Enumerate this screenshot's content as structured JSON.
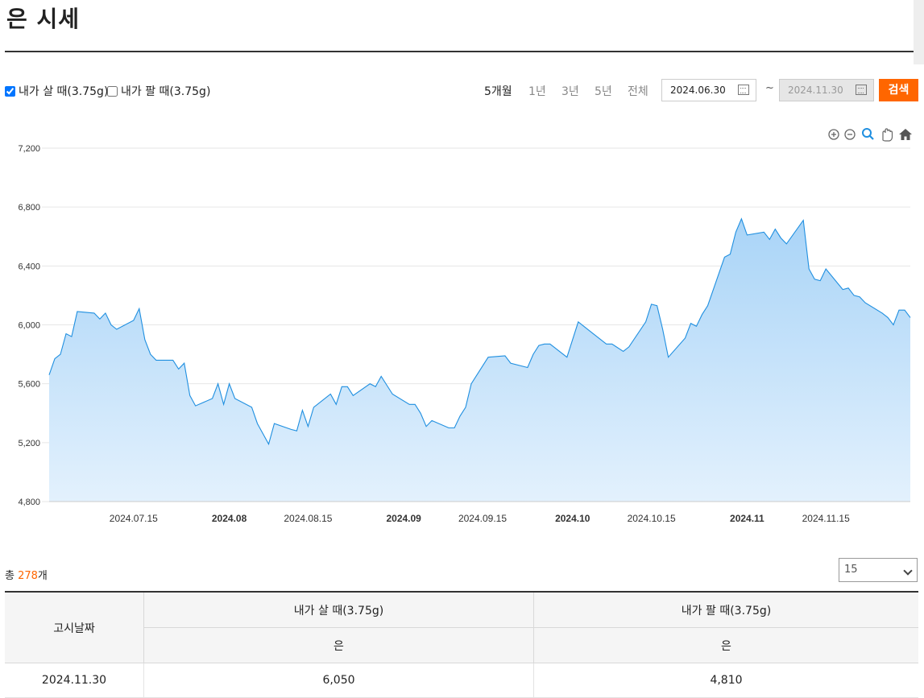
{
  "page": {
    "title": "은 시세"
  },
  "filters": {
    "buy_label": "내가 살 때(3.75g)",
    "buy_checked": true,
    "sell_label": "내가 팔 때(3.75g)",
    "sell_checked": false,
    "periods": [
      "5개월",
      "1년",
      "3년",
      "5년",
      "전체"
    ],
    "active_period": "5개월",
    "start_date": "2024.06.30",
    "end_date": "2024.11.30",
    "tilde": "~",
    "search_label": "검색"
  },
  "chart_data": {
    "type": "area",
    "series": [
      {
        "x": [
          "2024-06-30",
          "2024-07-01",
          "2024-07-02",
          "2024-07-03",
          "2024-07-04",
          "2024-07-05",
          "2024-07-08",
          "2024-07-09",
          "2024-07-10",
          "2024-07-11",
          "2024-07-12",
          "2024-07-15",
          "2024-07-16",
          "2024-07-17",
          "2024-07-18",
          "2024-07-19",
          "2024-07-22",
          "2024-07-23",
          "2024-07-24",
          "2024-07-25",
          "2024-07-26",
          "2024-07-29",
          "2024-07-30",
          "2024-07-31",
          "2024-08-01",
          "2024-08-02",
          "2024-08-05",
          "2024-08-06",
          "2024-08-07",
          "2024-08-08",
          "2024-08-09",
          "2024-08-12",
          "2024-08-13",
          "2024-08-14",
          "2024-08-15",
          "2024-08-16",
          "2024-08-19",
          "2024-08-20",
          "2024-08-21",
          "2024-08-22",
          "2024-08-23",
          "2024-08-26",
          "2024-08-27",
          "2024-08-28",
          "2024-08-29",
          "2024-08-30",
          "2024-09-02",
          "2024-09-03",
          "2024-09-04",
          "2024-09-05",
          "2024-09-06",
          "2024-09-09",
          "2024-09-10",
          "2024-09-11",
          "2024-09-12",
          "2024-09-13",
          "2024-09-16",
          "2024-09-19",
          "2024-09-20",
          "2024-09-23",
          "2024-09-24",
          "2024-09-25",
          "2024-09-26",
          "2024-09-27",
          "2024-09-30",
          "2024-10-02",
          "2024-10-04",
          "2024-10-07",
          "2024-10-08",
          "2024-10-10",
          "2024-10-11",
          "2024-10-14",
          "2024-10-15",
          "2024-10-16",
          "2024-10-17",
          "2024-10-18",
          "2024-10-21",
          "2024-10-22",
          "2024-10-23",
          "2024-10-24",
          "2024-10-25",
          "2024-10-28",
          "2024-10-29",
          "2024-10-30",
          "2024-10-31",
          "2024-11-01",
          "2024-11-04",
          "2024-11-05",
          "2024-11-06",
          "2024-11-07",
          "2024-11-08",
          "2024-11-11",
          "2024-11-12",
          "2024-11-13",
          "2024-11-14",
          "2024-11-15",
          "2024-11-18",
          "2024-11-19",
          "2024-11-20",
          "2024-11-21",
          "2024-11-22",
          "2024-11-25",
          "2024-11-26",
          "2024-11-27",
          "2024-11-28",
          "2024-11-29",
          "2024-11-30"
        ],
        "y": [
          5660,
          5770,
          5800,
          5940,
          5920,
          6090,
          6080,
          6040,
          6080,
          6000,
          5970,
          6030,
          6110,
          5900,
          5800,
          5760,
          5760,
          5700,
          5740,
          5520,
          5450,
          5500,
          5600,
          5460,
          5600,
          5500,
          5440,
          5330,
          5260,
          5190,
          5330,
          5290,
          5280,
          5420,
          5310,
          5440,
          5530,
          5460,
          5580,
          5580,
          5520,
          5600,
          5580,
          5650,
          5590,
          5530,
          5460,
          5460,
          5400,
          5310,
          5350,
          5300,
          5300,
          5380,
          5440,
          5600,
          5780,
          5790,
          5740,
          5710,
          5800,
          5860,
          5870,
          5870,
          5780,
          6020,
          5960,
          5870,
          5870,
          5820,
          5850,
          6020,
          6140,
          6130,
          5970,
          5780,
          5910,
          6010,
          5990,
          6070,
          6130,
          6460,
          6480,
          6630,
          6720,
          6610,
          6630,
          6580,
          6650,
          6590,
          6550,
          6710,
          6380,
          6310,
          6300,
          6380,
          6240,
          6250,
          6200,
          6190,
          6150,
          6080,
          6050,
          6000,
          6100,
          6100,
          6050
        ]
      }
    ],
    "y_ticks": [
      7200,
      6800,
      6400,
      6000,
      5600,
      5200,
      4800
    ],
    "y_tick_labels": [
      "7,200",
      "6,800",
      "6,400",
      "6,000",
      "5,600",
      "5,200",
      "4,800"
    ],
    "ylim": [
      4800,
      7200
    ],
    "x_ticks": [
      {
        "date": "2024-07-15",
        "label": "2024.07.15",
        "bold": false
      },
      {
        "date": "2024-08-01",
        "label": "2024.08",
        "bold": true
      },
      {
        "date": "2024-08-15",
        "label": "2024.08.15",
        "bold": false
      },
      {
        "date": "2024-09-01",
        "label": "2024.09",
        "bold": true
      },
      {
        "date": "2024-09-15",
        "label": "2024.09.15",
        "bold": false
      },
      {
        "date": "2024-10-01",
        "label": "2024.10",
        "bold": true
      },
      {
        "date": "2024-10-15",
        "label": "2024.10.15",
        "bold": false
      },
      {
        "date": "2024-11-01",
        "label": "2024.11",
        "bold": true
      },
      {
        "date": "2024-11-15",
        "label": "2024.11.15",
        "bold": false
      }
    ],
    "xlim": [
      "2024-06-30",
      "2024-11-30"
    ],
    "grid": true,
    "colors": {
      "line": "#1f8fe0",
      "fill_top": "#a9d4f7",
      "fill_bottom": "#e3f1fd"
    }
  },
  "chart_tools": [
    "zoom-in-icon",
    "zoom-out-icon",
    "magnify-icon",
    "pan-hand-icon",
    "home-icon"
  ],
  "summary": {
    "prefix": "총 ",
    "count": "278",
    "suffix": "개"
  },
  "page_size": {
    "selected": "15"
  },
  "table": {
    "date_header": "고시날짜",
    "buy_header": "내가 살 때(3.75g)",
    "sell_header": "내가 팔 때(3.75g)",
    "buy_sub": "은",
    "sell_sub": "은",
    "rows": [
      {
        "date": "2024.11.30",
        "buy": "6,050",
        "sell": "4,810"
      }
    ]
  }
}
